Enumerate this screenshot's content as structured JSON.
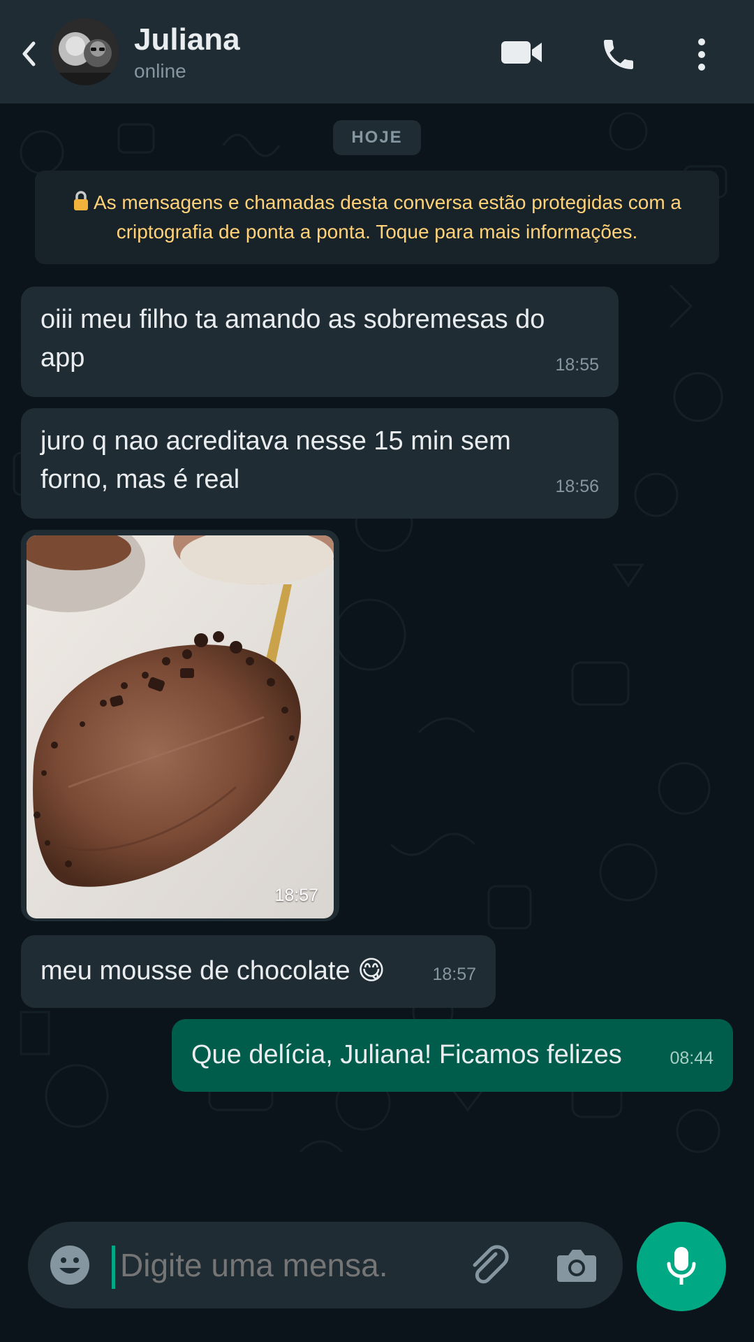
{
  "header": {
    "back_icon": "back-arrow-icon",
    "contact_name": "Juliana",
    "contact_status": "online",
    "video_icon": "video-call-icon",
    "call_icon": "phone-icon",
    "menu_icon": "more-vertical-icon"
  },
  "chat": {
    "date_chip": "HOJE",
    "e2e_notice": "As mensagens e chamadas desta conversa estão protegidas com a criptografia de ponta a ponta. Toque para mais informações.",
    "messages": [
      {
        "direction": "in",
        "line1": "oiii meu filho ta amando as sobremesas do",
        "line2": "app",
        "time": "18:55"
      },
      {
        "direction": "in",
        "line1": "juro q nao acreditava nesse 15 min sem",
        "line2": "forno, mas é real",
        "time": "18:56"
      },
      {
        "direction": "in",
        "type": "image",
        "image_desc": "chocolate-mousse-spoon-photo",
        "time": "18:57"
      },
      {
        "direction": "in",
        "text": "meu mousse de chocolate 😋",
        "time": "18:57"
      },
      {
        "direction": "out",
        "text": "Que delícia, Juliana! Ficamos felizes",
        "time": "08:44"
      }
    ]
  },
  "composer": {
    "placeholder": "Digite uma mensa...",
    "emoji_icon": "emoji-icon",
    "attach_icon": "paperclip-icon",
    "camera_icon": "camera-icon",
    "mic_icon": "microphone-icon"
  },
  "colors": {
    "header_bg": "#1f2c34",
    "chat_bg": "#0b141a",
    "incoming_bubble": "#202c33",
    "outgoing_bubble": "#005c4b",
    "accent": "#00a884",
    "notice_text": "#ffd279"
  }
}
